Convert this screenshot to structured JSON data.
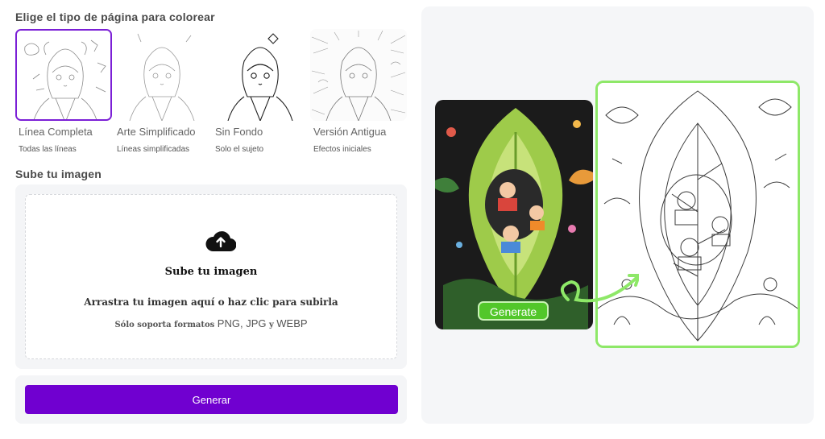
{
  "sections": {
    "style_title": "Elige el tipo de página para colorear",
    "upload_title": "Sube tu imagen"
  },
  "styles": [
    {
      "name": "Línea Completa",
      "desc": "Todas las líneas",
      "selected": true
    },
    {
      "name": "Arte Simplificado",
      "desc": "Líneas simplificadas",
      "selected": false
    },
    {
      "name": "Sin Fondo",
      "desc": "Solo el sujeto",
      "selected": false
    },
    {
      "name": "Versión Antigua",
      "desc": "Efectos iniciales",
      "selected": false
    }
  ],
  "upload": {
    "icon": "cloud-upload-icon",
    "title": "Sube tu imagen",
    "drag_text": "Arrastra tu imagen aquí o haz clic para subirla",
    "formats_prefix": "Sólo soporta formatos",
    "formats_list": "PNG, JPG",
    "formats_joiner": "y",
    "formats_last": "WEBP"
  },
  "generate_button": "Generar",
  "preview": {
    "chip_label": "Generate"
  },
  "colors": {
    "accent": "#7000d0",
    "selected_border": "#7b1fd6",
    "preview_highlight": "#8ee868",
    "chip": "#52c72a"
  }
}
